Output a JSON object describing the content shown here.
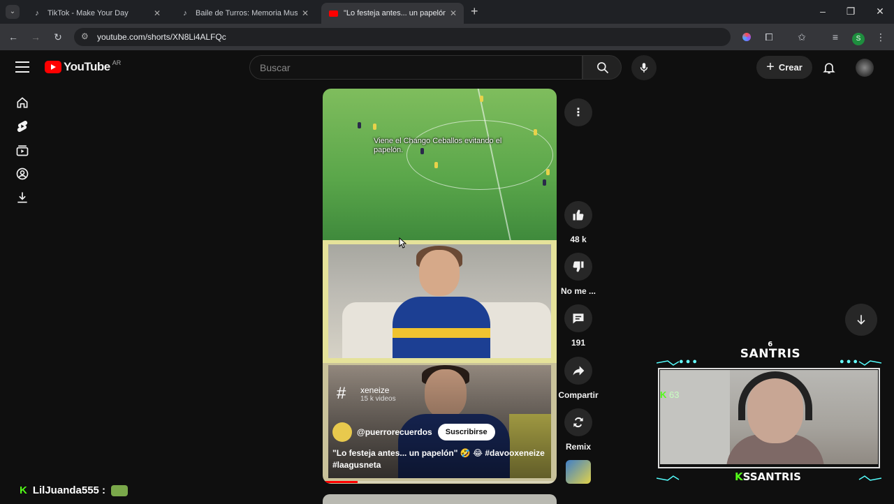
{
  "browser": {
    "tabs": [
      {
        "title": "TikTok - Make Your Day",
        "favicon": "tiktok-icon",
        "active": false
      },
      {
        "title": "Baile de Turros: Memoria Musc",
        "favicon": "tiktok-icon",
        "active": false
      },
      {
        "title": "\"Lo festeja antes... un papelón\"",
        "favicon": "youtube-icon",
        "active": true
      }
    ],
    "url": "youtube.com/shorts/XN8Li4ALFQc",
    "profile_initial": "S"
  },
  "header": {
    "logo_text": "YouTube",
    "country_code": "AR",
    "search_placeholder": "Buscar",
    "create_label": "Crear"
  },
  "short": {
    "caption": "Viene el Chango Ceballos evitando el papelón.",
    "hashtag": "xeneize",
    "hashtag_count": "15 k videos",
    "channel": "@puerrorecuerdos",
    "subscribe_label": "Suscribirse",
    "description": "\"Lo festeja antes... un papelón\" 🤣 😂 #davooxeneize #laagusneta",
    "progress": 0.15
  },
  "actions": {
    "likes": "48 k",
    "dislike_label": "No me ...",
    "comments": "191",
    "share_label": "Compartir",
    "remix_label": "Remix"
  },
  "stream": {
    "brand": "SANTRIS",
    "badge": "6",
    "viewers": "63",
    "kick_letter": "K",
    "streamer_name": "SSANTRIS",
    "chat_user": "LilJuanda555 :"
  },
  "colors": {
    "yt_red": "#ff0000",
    "kick_green": "#53fc18",
    "bg": "#0f0f0f"
  }
}
